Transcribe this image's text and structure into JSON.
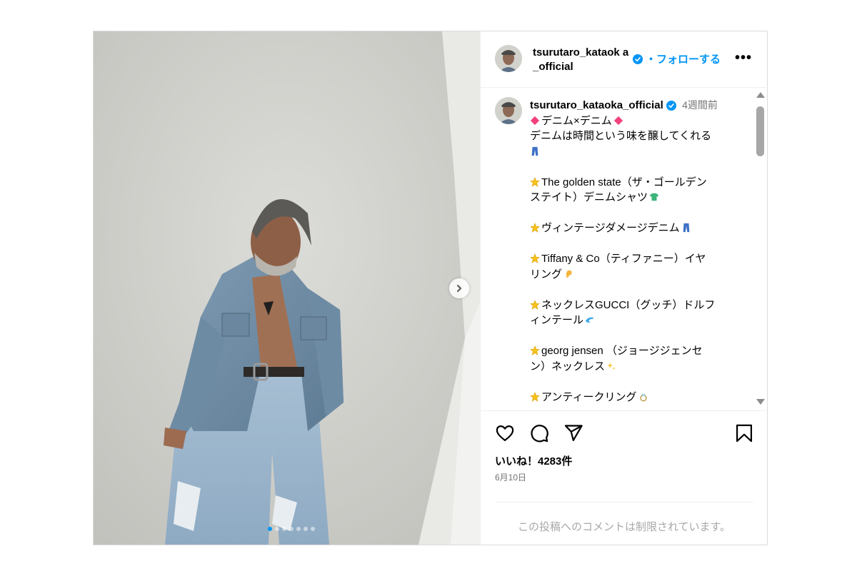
{
  "post": {
    "username": "tsurutaro_kataoka_official",
    "username_head": "tsurutaro_kataok a_official",
    "follow_label": "・フォローする",
    "more_label": "•••",
    "time_ago": "4週間前",
    "caption": [
      {
        "emoji": "diamond-pink",
        "text": "デニム×デニム",
        "trail": "diamond-pink"
      },
      {
        "text": "デニムは時間という味を醸してくれる"
      },
      {
        "emoji": "jeans",
        "text": ""
      },
      {
        "blank": true
      },
      {
        "emoji": "star",
        "text": "The golden state（ザ・ゴールデン"
      },
      {
        "text": "ステイト）デニムシャツ",
        "trail": "tshirt"
      },
      {
        "blank": true
      },
      {
        "emoji": "star",
        "text": "ヴィンテージダメージデニム",
        "trail": "jeans"
      },
      {
        "blank": true
      },
      {
        "emoji": "star",
        "text": "Tiffany & Co（ティファニー）イヤ"
      },
      {
        "text": "リング",
        "trail": "ear"
      },
      {
        "blank": true
      },
      {
        "emoji": "star",
        "text": "ネックレスGUCCI（グッチ）ドルフ"
      },
      {
        "text": "ィンテール",
        "trail": "dolphin"
      },
      {
        "blank": true
      },
      {
        "emoji": "star",
        "text": "georg jensen （ジョージジェンセ"
      },
      {
        "text": "ン）ネックレス",
        "trail": "sparkles"
      },
      {
        "blank": true
      },
      {
        "emoji": "star",
        "text": "アンティークリング",
        "trail": "ring"
      }
    ],
    "likes": "いいね！4283件",
    "date": "6月10日",
    "comments_limited": "この投稿へのコメントは制限されています。",
    "carousel_count": 7,
    "carousel_active": 0
  },
  "colors": {
    "accent": "#0095f6",
    "secondary_text": "#737373",
    "border": "#dbdbdb"
  }
}
